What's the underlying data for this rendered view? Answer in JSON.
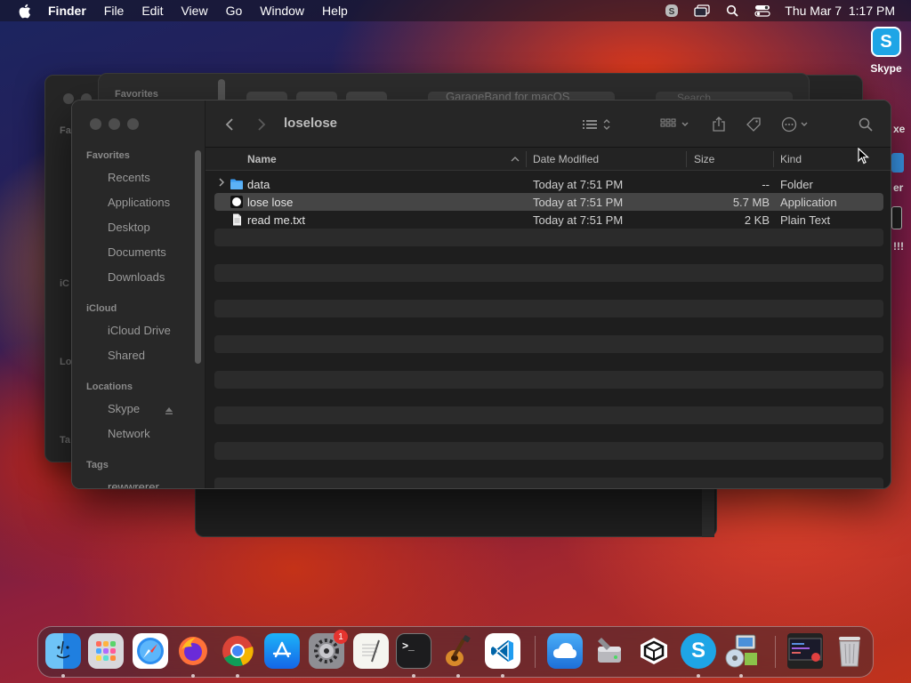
{
  "menubar": {
    "app_name": "Finder",
    "items": [
      "File",
      "Edit",
      "View",
      "Go",
      "Window",
      "Help"
    ],
    "clock": "Thu Mar 7  1:17 PM",
    "status_icons": [
      "skype-status-icon",
      "screen-mirroring-icon",
      "spotlight-search-icon",
      "control-center-icon"
    ]
  },
  "desktop": {
    "skype_label": "Skype",
    "clipped_labels": [
      "xe",
      "er",
      "!!!"
    ]
  },
  "back_window": {
    "favorites_label": "Favorites",
    "path_popup": "GarageBand for macOS",
    "search_placeholder": "Search",
    "clipped_sidebar": [
      "Fa",
      "iC",
      "Lo",
      "Ta"
    ]
  },
  "finder": {
    "title": "loselose",
    "sidebar": {
      "favorites_label": "Favorites",
      "favorites": [
        "Recents",
        "Applications",
        "Desktop",
        "Documents",
        "Downloads"
      ],
      "icloud_label": "iCloud",
      "icloud": [
        "iCloud Drive",
        "Shared"
      ],
      "locations_label": "Locations",
      "locations": [
        "Skype",
        "Network"
      ],
      "tags_label": "Tags",
      "tags": [
        "rewwrerer"
      ]
    },
    "columns": {
      "name": "Name",
      "date": "Date Modified",
      "size": "Size",
      "kind": "Kind"
    },
    "files": [
      {
        "name": "data",
        "date": "Today at 7:51 PM",
        "size": "--",
        "kind": "Folder",
        "icon": "folder-icon"
      },
      {
        "name": "lose lose",
        "date": "Today at 7:51 PM",
        "size": "5.7 MB",
        "kind": "Application",
        "icon": "app-icon"
      },
      {
        "name": "read me.txt",
        "date": "Today at 7:51 PM",
        "size": "2 KB",
        "kind": "Plain Text",
        "icon": "text-file-icon"
      }
    ]
  },
  "dock": {
    "apps": [
      "Finder",
      "Launchpad",
      "Safari",
      "Firefox",
      "Chrome",
      "App Store",
      "System Settings",
      "TextEdit",
      "Terminal",
      "GarageBand",
      "Visual Studio Code",
      "iCloud",
      "Disk Utility",
      "Ubiquiti",
      "Skype",
      "Installer",
      "Screen Recording",
      "Trash"
    ],
    "badge_system_settings": "1",
    "terminal_prompt": ">_"
  },
  "colors": {
    "accent_folder": "#3b9cf2",
    "window_bg": "#1e1e1e",
    "selected_row": "#454545"
  }
}
